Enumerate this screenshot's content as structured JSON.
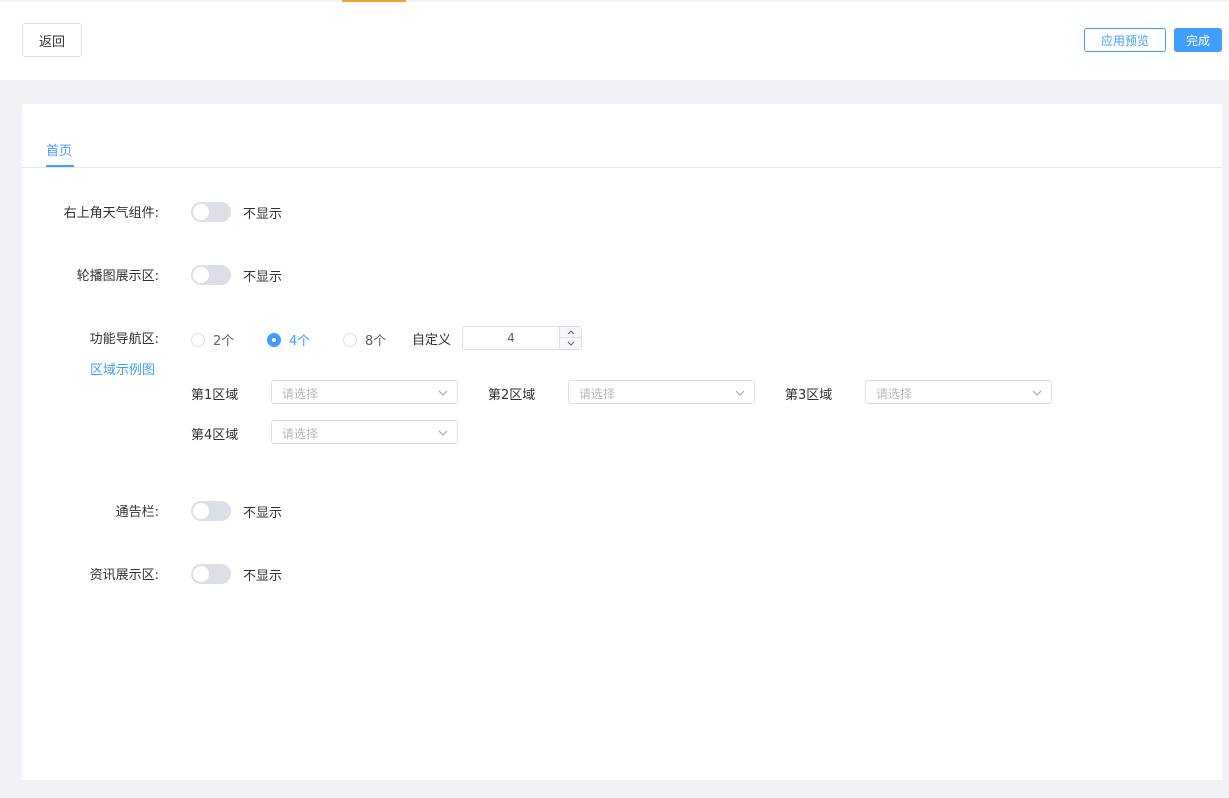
{
  "header": {
    "back_label": "返回",
    "preview_label": "应用预览",
    "done_label": "完成"
  },
  "tabs": [
    {
      "label": "首页",
      "active": true
    }
  ],
  "form": {
    "weather": {
      "label": "右上角天气组件:",
      "state_text": "不显示",
      "on": false
    },
    "carousel": {
      "label": "轮播图展示区:",
      "state_text": "不显示",
      "on": false
    },
    "nav": {
      "label": "功能导航区:",
      "example_link": "区域示例图",
      "options": [
        {
          "label": "2个",
          "checked": false
        },
        {
          "label": "4个",
          "checked": true
        },
        {
          "label": "8个",
          "checked": false
        }
      ],
      "custom_label": "自定义",
      "custom_value": "4",
      "regions": [
        {
          "label": "第1区域",
          "placeholder": "请选择"
        },
        {
          "label": "第2区域",
          "placeholder": "请选择"
        },
        {
          "label": "第3区域",
          "placeholder": "请选择"
        },
        {
          "label": "第4区域",
          "placeholder": "请选择"
        }
      ]
    },
    "notice": {
      "label": "通告栏:",
      "state_text": "不显示",
      "on": false
    },
    "news": {
      "label": "资讯展示区:",
      "state_text": "不显示",
      "on": false
    }
  },
  "colors": {
    "accent": "#409eff",
    "top_accent": "#f0a52b",
    "switch_off": "#dcdfe6"
  }
}
